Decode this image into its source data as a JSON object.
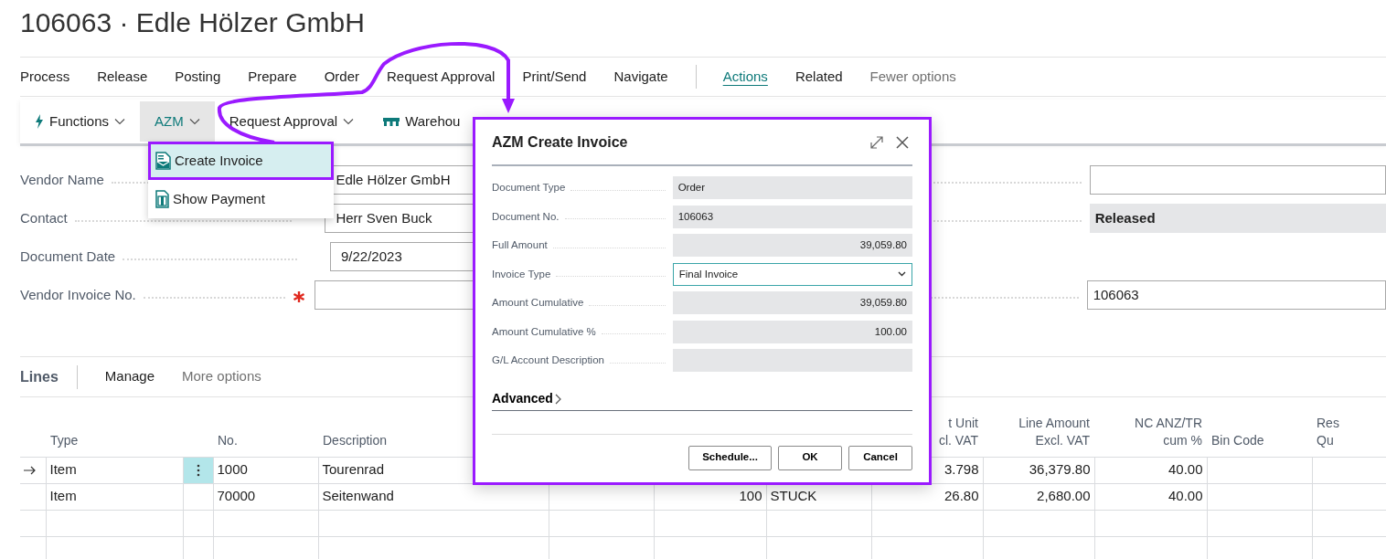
{
  "page_title": "106063 · Edle Hölzer GmbH",
  "promoted_actions": [
    {
      "label": "Process"
    },
    {
      "label": "Release"
    },
    {
      "label": "Posting"
    },
    {
      "label": "Prepare"
    },
    {
      "label": "Order"
    },
    {
      "label": "Request Approval"
    },
    {
      "label": "Print/Send"
    },
    {
      "label": "Navigate"
    }
  ],
  "action_menus": [
    {
      "label": "Actions",
      "selected": true
    },
    {
      "label": "Related",
      "selected": false
    }
  ],
  "fewer_options": "Fewer options",
  "toolbar": [
    {
      "label": "Functions",
      "has_menu": true,
      "selected": false
    },
    {
      "label": "AZM",
      "has_menu": true,
      "selected": true
    },
    {
      "label": "Request Approval",
      "has_menu": true,
      "selected": false
    },
    {
      "label": "Warehou",
      "has_menu": false,
      "selected": false
    }
  ],
  "dropdown": [
    {
      "label": "Create Invoice",
      "selected": true
    },
    {
      "label": "Show Payment",
      "selected": false
    }
  ],
  "general_fields": [
    {
      "label": "Vendor Name",
      "value": "Edle Hölzer GmbH",
      "required": false
    },
    {
      "label": "Contact",
      "value": "Herr Sven Buck",
      "required": false
    },
    {
      "label": "Document Date",
      "value": "9/22/2023",
      "required": false
    },
    {
      "label": "Vendor Invoice No.",
      "required": true
    }
  ],
  "right_fields": [
    {
      "kind": "input"
    },
    {
      "kind": "status",
      "value": "Released"
    },
    {
      "kind": "blank"
    },
    {
      "kind": "input",
      "value": "106063"
    }
  ],
  "lines": {
    "title": "Lines",
    "actions": [
      {
        "label": "Manage",
        "muted": false
      },
      {
        "label": "More options",
        "muted": true
      }
    ],
    "columns": [
      {
        "heading": [
          "Type"
        ],
        "numeric": false
      },
      {},
      {
        "heading": [
          "No."
        ],
        "numeric": false
      },
      {
        "heading": [
          "Description"
        ],
        "numeric": false
      },
      {},
      {
        "numeric": true
      },
      {
        "numeric": false
      },
      {
        "heading": [
          "t Unit",
          "cl. VAT"
        ],
        "numeric": true
      },
      {
        "heading": [
          "Line Amount",
          "Excl. VAT"
        ],
        "numeric": true
      },
      {
        "heading": [
          "NC ANZ/TR",
          "cum %"
        ],
        "numeric": true
      },
      {
        "heading": [
          "Bin Code"
        ],
        "numeric": false
      },
      {
        "heading": [
          "Res",
          "Qu"
        ],
        "numeric": false
      }
    ],
    "rows": [
      {
        "current": true,
        "cells": [
          "Item",
          null,
          "1000",
          "Tourenrad",
          null,
          null,
          null,
          "3.798",
          "36,379.80",
          "40.00",
          null,
          null
        ]
      },
      {
        "current": false,
        "cells": [
          "Item",
          null,
          "70000",
          "Seitenwand",
          null,
          "100",
          "STUCK",
          "26.80",
          "2,680.00",
          "40.00",
          null,
          null
        ]
      },
      {
        "current": false,
        "cells": [
          null,
          null,
          null,
          null,
          null,
          null,
          null,
          null,
          null,
          null,
          null,
          null
        ]
      },
      {
        "current": false,
        "cells": [
          null,
          null,
          null,
          null,
          null,
          null,
          null,
          null,
          null,
          null,
          null,
          null
        ]
      }
    ]
  },
  "dialog": {
    "title": "AZM Create Invoice",
    "fields": [
      {
        "label": "Document Type",
        "value": "Order",
        "kind": "readonly",
        "numeric": false
      },
      {
        "label": "Document No.",
        "value": "106063",
        "kind": "readonly",
        "numeric": false
      },
      {
        "label": "Full Amount",
        "value": "39,059.80",
        "kind": "readonly",
        "numeric": true
      },
      {
        "label": "Invoice Type",
        "value": "Final Invoice",
        "kind": "select"
      },
      {
        "label": "Amount Cumulative",
        "value": "39,059.80",
        "kind": "readonly",
        "numeric": true
      },
      {
        "label": "Amount Cumulative %",
        "value": "100.00",
        "kind": "readonly",
        "numeric": true
      },
      {
        "label": "G/L Account Description",
        "kind": "readonly"
      }
    ],
    "section": "Advanced",
    "buttons": [
      "Schedule...",
      "OK",
      "Cancel"
    ]
  }
}
